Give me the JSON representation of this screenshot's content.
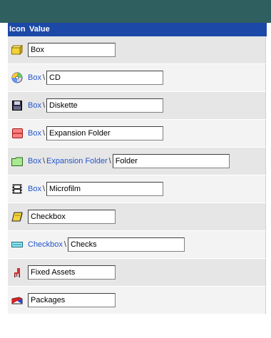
{
  "header": {
    "icon_col": "Icon",
    "value_col": "Value"
  },
  "colors": {
    "header_bg": "#1c49a8",
    "topbar_bg": "#2f5f5f",
    "breadcrumb": "#2255cc"
  },
  "rows": [
    {
      "icon": "box-icon",
      "path": [],
      "value": "Box"
    },
    {
      "icon": "cd-icon",
      "path": [
        "Box"
      ],
      "value": "CD"
    },
    {
      "icon": "diskette-icon",
      "path": [
        "Box"
      ],
      "value": "Diskette"
    },
    {
      "icon": "expansion-folder-icon",
      "path": [
        "Box"
      ],
      "value": "Expansion Folder"
    },
    {
      "icon": "folder-icon",
      "path": [
        "Box",
        "Expansion Folder"
      ],
      "value": "Folder"
    },
    {
      "icon": "microfilm-icon",
      "path": [
        "Box"
      ],
      "value": "Microfilm"
    },
    {
      "icon": "checkbox-icon",
      "path": [],
      "value": "Checkbox"
    },
    {
      "icon": "checks-icon",
      "path": [
        "Checkbox"
      ],
      "value": "Checks"
    },
    {
      "icon": "fixed-assets-icon",
      "path": [],
      "value": "Fixed Assets"
    },
    {
      "icon": "packages-icon",
      "path": [],
      "value": "Packages"
    }
  ]
}
